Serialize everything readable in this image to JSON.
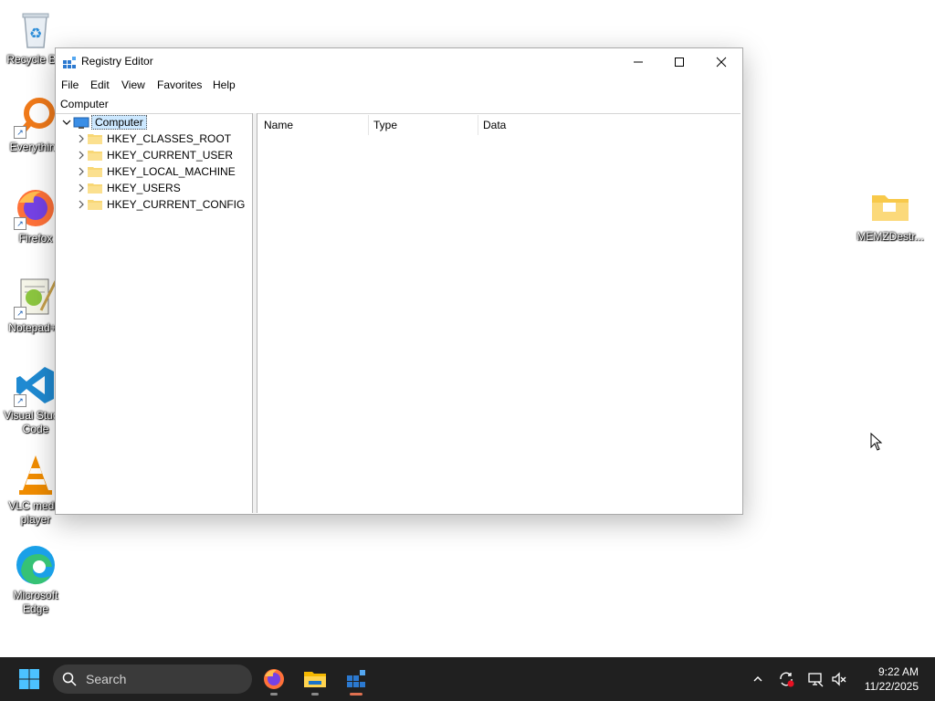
{
  "desktop": {
    "icons_left": [
      {
        "name": "recycle-bin",
        "label": "Recycle Bin"
      },
      {
        "name": "everything",
        "label": "Everything"
      },
      {
        "name": "firefox",
        "label": "Firefox"
      },
      {
        "name": "notepadpp",
        "label": "Notepad++"
      },
      {
        "name": "vscode",
        "label": "Visual Studio Code"
      },
      {
        "name": "vlc",
        "label": "VLC media player"
      },
      {
        "name": "edge",
        "label": "Microsoft Edge"
      }
    ],
    "icon_right": {
      "name": "memz-folder",
      "label": "MEMZDestr..."
    }
  },
  "window": {
    "title": "Registry Editor",
    "controls": {
      "minimize": "minimize-icon",
      "maximize": "maximize-icon",
      "close": "close-icon"
    },
    "menu": [
      "File",
      "Edit",
      "View",
      "Favorites",
      "Help"
    ],
    "address": "Computer",
    "tree": {
      "root": "Computer",
      "children": [
        "HKEY_CLASSES_ROOT",
        "HKEY_CURRENT_USER",
        "HKEY_LOCAL_MACHINE",
        "HKEY_USERS",
        "HKEY_CURRENT_CONFIG"
      ]
    },
    "columns": [
      "Name",
      "Type",
      "Data"
    ]
  },
  "taskbar": {
    "search_placeholder": "Search",
    "apps": [
      "firefox-icon",
      "file-explorer-icon",
      "registry-editor-icon"
    ],
    "clock": {
      "time": "9:22 AM",
      "date": "11/22/2025"
    }
  },
  "colors": {
    "taskbar_bg": "#202020",
    "selection": "#cce8ff",
    "folder": "#f8d775"
  }
}
